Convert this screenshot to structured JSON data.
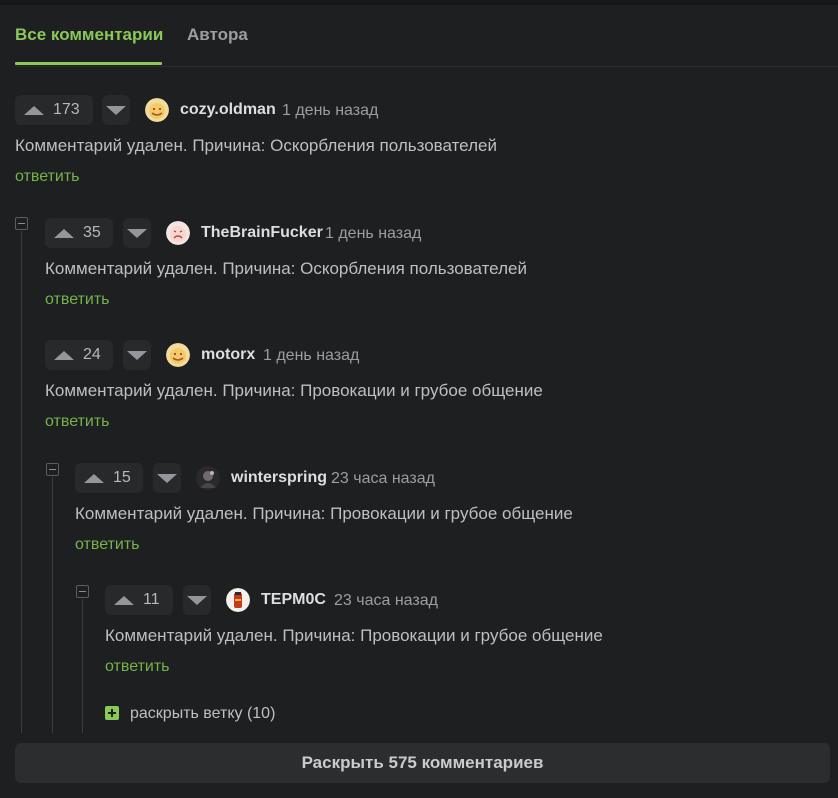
{
  "tabs": [
    {
      "label": "Все комментарии",
      "active": true
    },
    {
      "label": "Автора",
      "active": false
    }
  ],
  "comments": [
    {
      "score": "173",
      "author": "cozy.oldman",
      "time": "1 день назад",
      "text": "Комментарий удален. Причина: Оскорбления пользователей",
      "reply": "ответить",
      "avatar": "smiling-face-avatar"
    },
    {
      "score": "35",
      "author": "TheBrainFucker",
      "time": "1 день назад",
      "text": "Комментарий удален. Причина: Оскорбления пользователей",
      "reply": "ответить",
      "avatar": "crying-face-avatar"
    },
    {
      "score": "24",
      "author": "motorx",
      "time": "1 день назад",
      "text": "Комментарий удален. Причина: Провокации и грубое общение",
      "reply": "ответить",
      "avatar": "smiling-face-avatar"
    },
    {
      "score": "15",
      "author": "winterspring",
      "time": "23 часа назад",
      "text": "Комментарий удален. Причина: Провокации и грубое общение",
      "reply": "ответить",
      "avatar": "dark-photo-avatar"
    },
    {
      "score": "11",
      "author": "TEPM0C",
      "time": "23 часа назад",
      "text": "Комментарий удален. Причина: Провокации и грубое общение",
      "reply": "ответить",
      "avatar": "thermos-avatar"
    }
  ],
  "expand_branch": {
    "label": "раскрыть ветку (10)"
  },
  "show_all": {
    "label": "Раскрыть 575 комментариев"
  },
  "colors": {
    "accent": "#8ac858",
    "link": "#75b34b",
    "background": "#1e1f20"
  }
}
